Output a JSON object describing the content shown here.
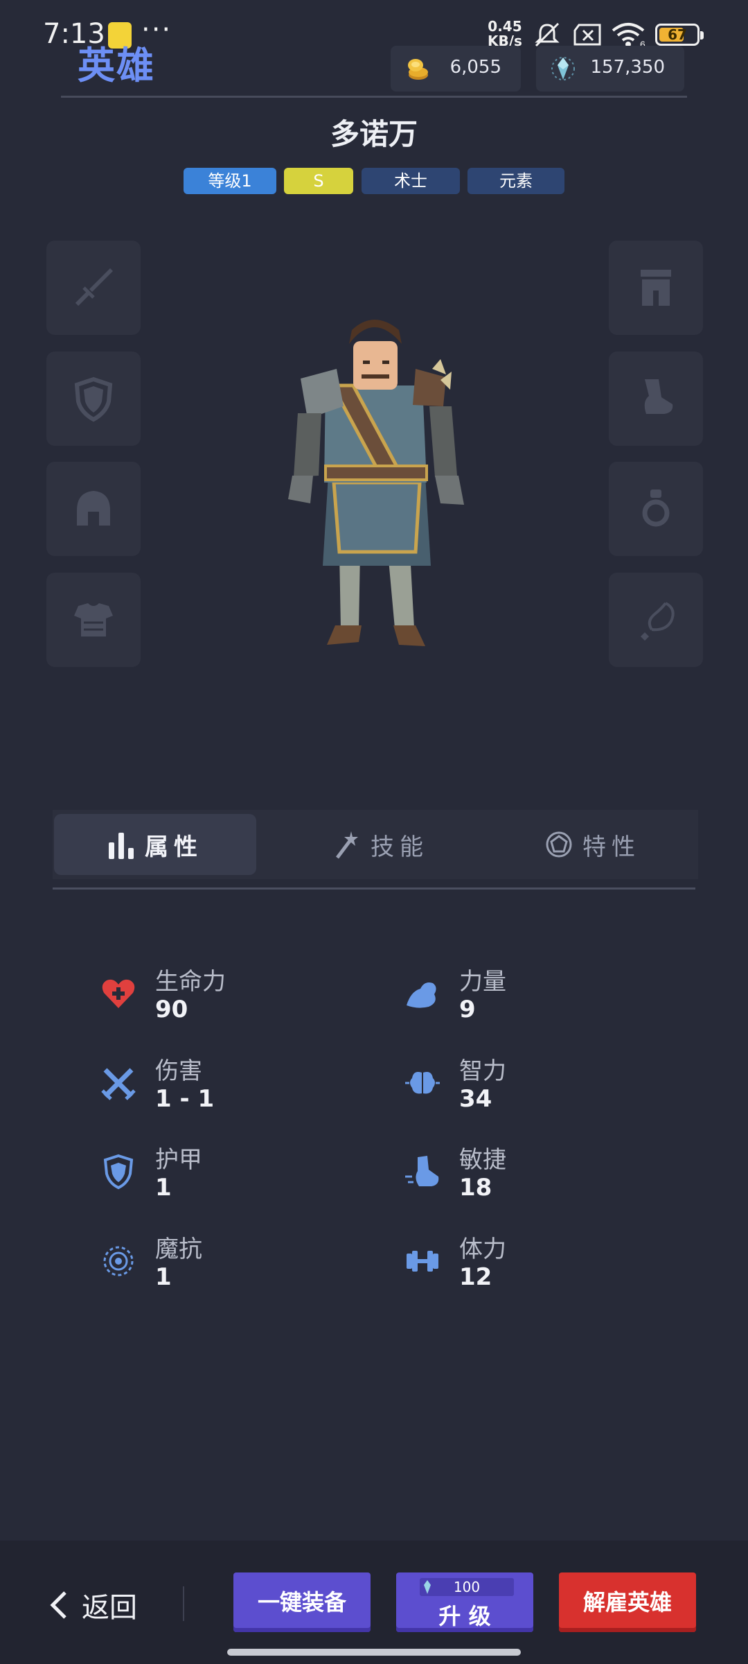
{
  "status_bar": {
    "time": "7:13",
    "dots": "···",
    "net_speed_value": "0.45",
    "net_speed_unit": "KB/s",
    "battery": "67",
    "battery_level": 0.67,
    "wifi_badge": "6"
  },
  "header": {
    "title": "英雄",
    "gold": "6,055",
    "gems": "157,350"
  },
  "hero": {
    "name": "多诺万",
    "tags": [
      "等级1",
      "S",
      "术士",
      "元素"
    ]
  },
  "equipment": {
    "left": [
      "sword-slot",
      "shield-slot",
      "helmet-slot",
      "armor-slot"
    ],
    "right": [
      "pants-slot",
      "boots-slot",
      "ring-slot",
      "necklace-slot"
    ]
  },
  "tabs": [
    "属性",
    "技能",
    "特性"
  ],
  "stats": {
    "left": [
      {
        "label": "生命力",
        "value": "90",
        "icon": "heart-icon"
      },
      {
        "label": "伤害",
        "value": "1 - 1",
        "icon": "crossed-swords-icon"
      },
      {
        "label": "护甲",
        "value": "1",
        "icon": "shield-icon"
      },
      {
        "label": "魔抗",
        "value": "1",
        "icon": "spiral-icon"
      }
    ],
    "right": [
      {
        "label": "力量",
        "value": "9",
        "icon": "arm-icon"
      },
      {
        "label": "智力",
        "value": "34",
        "icon": "brain-icon"
      },
      {
        "label": "敏捷",
        "value": "18",
        "icon": "boot-icon"
      },
      {
        "label": "体力",
        "value": "12",
        "icon": "dumbbell-icon"
      }
    ]
  },
  "bottom": {
    "back": "返回",
    "equip_all": "一键装备",
    "upgrade_cost": "100",
    "upgrade": "升 级",
    "dismiss": "解雇英雄"
  },
  "colors": {
    "background": "#272a38",
    "accent_blue": "#5c4ecf",
    "danger_red": "#d8312e",
    "title_blue": "#6d8ff5",
    "tag_level": "#3b82d8",
    "tag_rank": "#d6d23d",
    "tag_class": "#2e4572"
  }
}
